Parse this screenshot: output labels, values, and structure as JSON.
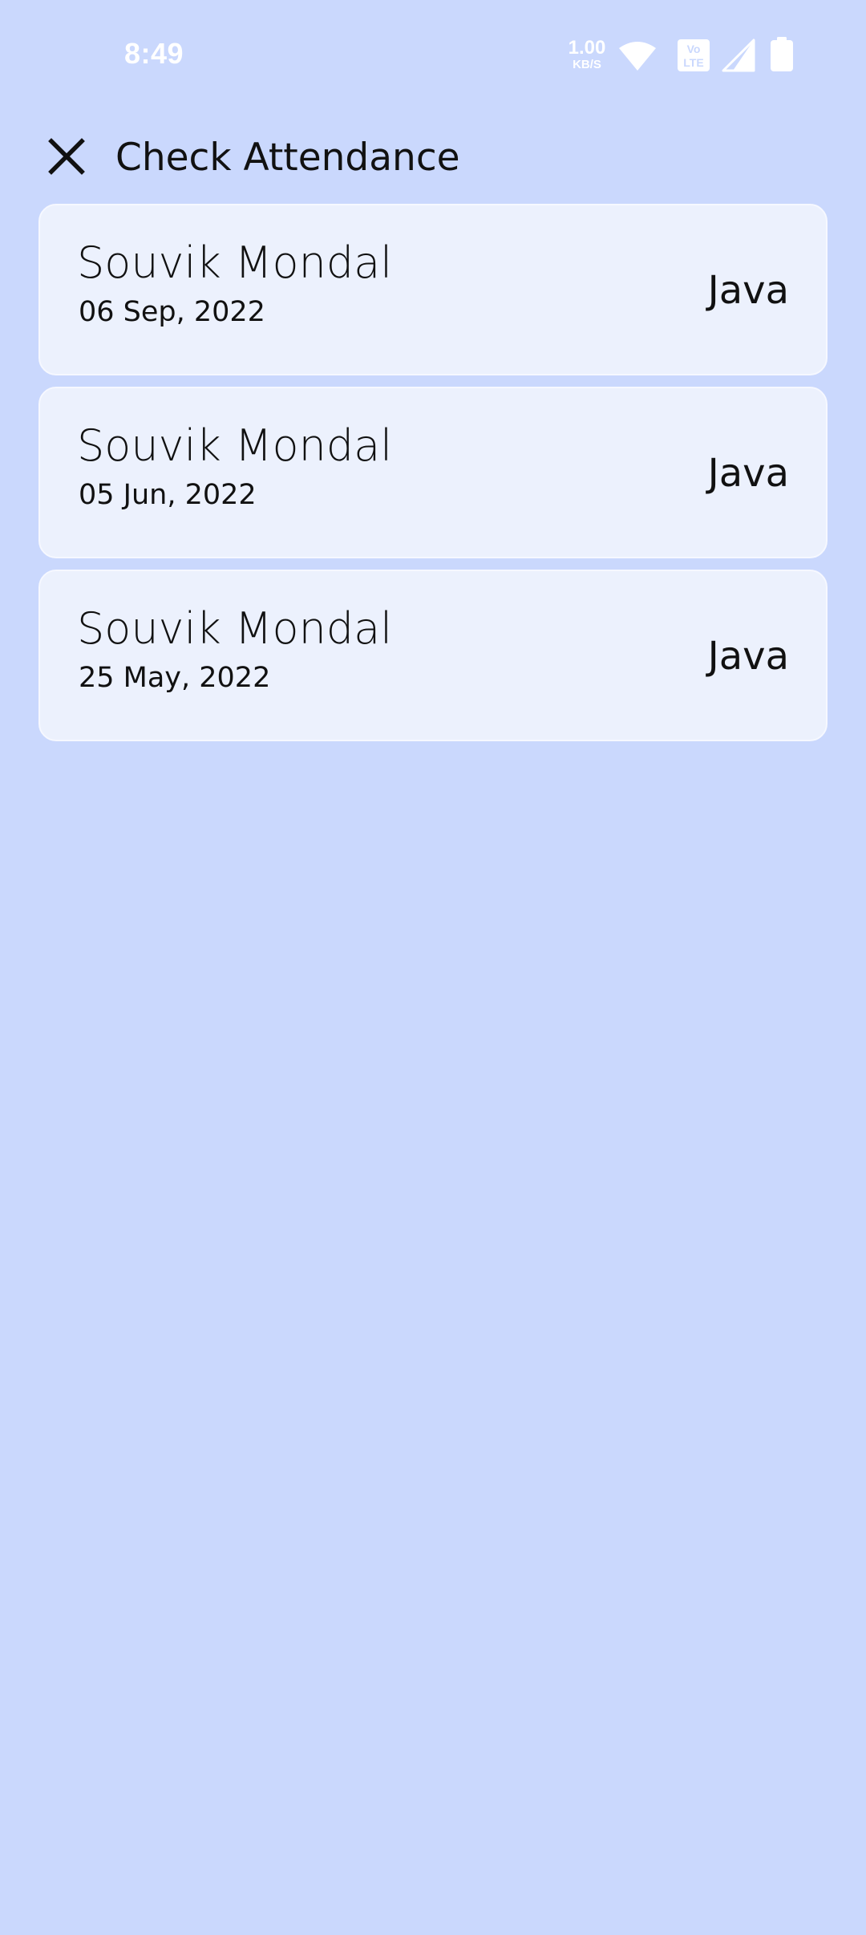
{
  "status_bar": {
    "time": "8:49",
    "net_speed_value": "1.00",
    "net_speed_unit": "KB/S",
    "icons": [
      "wifi-icon",
      "volte-icon",
      "signal-icon",
      "battery-icon"
    ]
  },
  "header": {
    "close_icon": "close-icon",
    "title": "Check Attendance"
  },
  "records": [
    {
      "name": "Souvik Mondal",
      "date": "06 Sep, 2022",
      "subject": "Java"
    },
    {
      "name": "Souvik Mondal",
      "date": "05 Jun, 2022",
      "subject": "Java"
    },
    {
      "name": "Souvik Mondal",
      "date": "25 May, 2022",
      "subject": "Java"
    }
  ],
  "colors": {
    "background": "#cad8fd",
    "card_background": "#ecf1fd",
    "text": "#111111",
    "status_bar_text": "#ffffff"
  }
}
